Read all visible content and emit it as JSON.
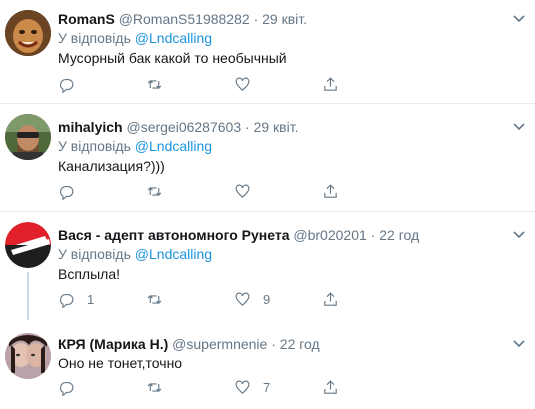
{
  "tweets": [
    {
      "name": "RomanS",
      "handle": "@RomanS51988282",
      "separator": "·",
      "time": "29 квіт.",
      "reply_prefix": "У відповідь",
      "reply_to": "@Lndcalling",
      "text": "Мусорный бак какой то необычный",
      "reply_count": "",
      "like_count": ""
    },
    {
      "name": "mihalyich",
      "handle": "@sergei06287603",
      "separator": "·",
      "time": "29 квіт.",
      "reply_prefix": "У відповідь",
      "reply_to": "@Lndcalling",
      "text": "Канализация?)))",
      "reply_count": "",
      "like_count": ""
    },
    {
      "name": "Вася - адепт автономного Рунета",
      "handle": "@br020201",
      "separator": "·",
      "time": "22 год",
      "reply_prefix": "У відповідь",
      "reply_to": "@Lndcalling",
      "text": "Всплыла!",
      "reply_count": "1",
      "like_count": "9"
    },
    {
      "name": "КРЯ (Марика Н.)",
      "handle": "@supermnenie",
      "separator": "·",
      "time": "22 год",
      "text": "Оно не тонет,точно",
      "reply_count": "",
      "like_count": "7"
    }
  ],
  "icons": [
    "reply-icon",
    "retweet-icon",
    "like-icon",
    "share-icon",
    "chevron-down-icon"
  ],
  "colors": {
    "secondary_text": "#657786",
    "link": "#1b95e0",
    "divider": "#e6ecf0",
    "thread_line": "#ccd6dd"
  }
}
